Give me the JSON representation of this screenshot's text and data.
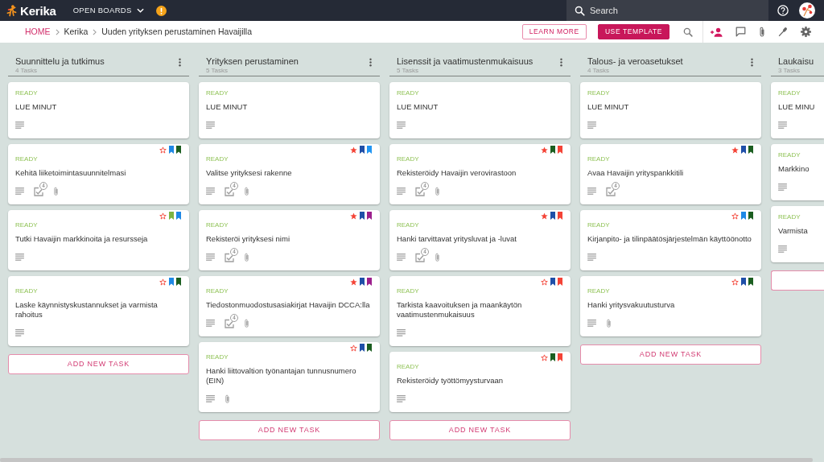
{
  "top_bar": {
    "logo": "Kerika",
    "menu": "OPEN BOARDS",
    "search": {
      "placeholder": "Search"
    }
  },
  "breadcrumb": [
    {
      "label": "HOME",
      "kind": "link"
    },
    {
      "label": "Kerika",
      "kind": "text"
    },
    {
      "label": "Uuden yrityksen perustaminen Havaijilla",
      "kind": "text"
    }
  ],
  "actions": [
    {
      "label": "LEARN MORE",
      "kind": "outline"
    },
    {
      "label": "USE TEMPLATE",
      "kind": "filled"
    }
  ],
  "columns": [
    {
      "title": "Suunnittelu ja tutkimus",
      "task_count": "4 Tasks",
      "has_menu": true,
      "tasks": [
        {
          "status": "READY",
          "title": "LUE MINUT",
          "indicators": [
            {
              "kind": "description"
            }
          ]
        },
        {
          "status": "READY",
          "title": "Kehitä liiketoimintasuunnitelmasi",
          "starred": false,
          "tags": [
            {
              "color": "#1e88e5"
            },
            {
              "color": "#1b5e20"
            }
          ],
          "indicators": [
            {
              "kind": "description"
            },
            {
              "kind": "checklist",
              "count": "4"
            },
            {
              "kind": "attachment"
            }
          ]
        },
        {
          "status": "READY",
          "title": "Tutki Havaijin markkinoita ja resursseja",
          "starred": false,
          "tags": [
            {
              "color": "#7cb342"
            },
            {
              "color": "#1e88e5"
            }
          ],
          "indicators": [
            {
              "kind": "description"
            }
          ]
        },
        {
          "status": "READY",
          "title": "Laske käynnistyskustannukset ja varmista rahoitus",
          "starred": false,
          "tags": [
            {
              "color": "#1e88e5"
            },
            {
              "color": "#1b5e20"
            }
          ],
          "indicators": [
            {
              "kind": "description"
            }
          ]
        }
      ],
      "add_button": {
        "kind": "labeled",
        "label": "ADD NEW TASK"
      }
    },
    {
      "title": "Yrityksen perustaminen",
      "task_count": "5 Tasks",
      "has_menu": true,
      "tasks": [
        {
          "status": "READY",
          "title": "LUE MINUT",
          "indicators": [
            {
              "kind": "description"
            }
          ]
        },
        {
          "status": "READY",
          "title": "Valitse yrityksesi rakenne",
          "starred": true,
          "tags": [
            {
              "color": "#1f4fa8"
            },
            {
              "color": "#2196f3"
            }
          ],
          "indicators": [
            {
              "kind": "description"
            },
            {
              "kind": "checklist",
              "count": "4"
            },
            {
              "kind": "attachment"
            }
          ]
        },
        {
          "status": "READY",
          "title": "Rekisteröi yrityksesi nimi",
          "starred": true,
          "tags": [
            {
              "color": "#1f4fa8"
            },
            {
              "color": "#9c1f8c"
            }
          ],
          "indicators": [
            {
              "kind": "description"
            },
            {
              "kind": "checklist",
              "count": "4"
            },
            {
              "kind": "attachment"
            }
          ]
        },
        {
          "status": "READY",
          "title": "Tiedostonmuodostusasiakirjat Havaijin DCCA:lla",
          "starred": true,
          "tags": [
            {
              "color": "#1f4fa8"
            },
            {
              "color": "#9c1f8c"
            }
          ],
          "indicators": [
            {
              "kind": "description"
            },
            {
              "kind": "checklist",
              "count": "4"
            },
            {
              "kind": "attachment"
            }
          ]
        },
        {
          "status": "READY",
          "title": "Hanki liittovaltion työnantajan tunnusnumero (EIN)",
          "starred": false,
          "tags": [
            {
              "color": "#1f4fa8"
            },
            {
              "color": "#1b5e20"
            }
          ],
          "indicators": [
            {
              "kind": "description"
            },
            {
              "kind": "attachment"
            }
          ]
        }
      ],
      "add_button": {
        "kind": "labeled",
        "label": "ADD NEW TASK"
      }
    },
    {
      "title": "Lisenssit ja vaatimustenmukaisuus",
      "task_count": "5 Tasks",
      "has_menu": true,
      "tasks": [
        {
          "status": "READY",
          "title": "LUE MINUT",
          "indicators": [
            {
              "kind": "description"
            }
          ]
        },
        {
          "status": "READY",
          "title": "Rekisteröidy Havaijin verovirastoon",
          "starred": true,
          "tags": [
            {
              "color": "#1b5e20"
            },
            {
              "color": "#f44336"
            }
          ],
          "indicators": [
            {
              "kind": "description"
            },
            {
              "kind": "checklist",
              "count": "4"
            },
            {
              "kind": "attachment"
            }
          ]
        },
        {
          "status": "READY",
          "title": "Hanki tarvittavat yritysluvat ja -luvat",
          "starred": true,
          "tags": [
            {
              "color": "#1f4fa8"
            },
            {
              "color": "#f44336"
            }
          ],
          "indicators": [
            {
              "kind": "description"
            },
            {
              "kind": "checklist",
              "count": "4"
            },
            {
              "kind": "attachment"
            }
          ]
        },
        {
          "status": "READY",
          "title": "Tarkista kaavoituksen ja maankäytön vaatimustenmukaisuus",
          "starred": false,
          "tags": [
            {
              "color": "#1f4fa8"
            },
            {
              "color": "#f44336"
            }
          ],
          "indicators": [
            {
              "kind": "description"
            }
          ]
        },
        {
          "status": "READY",
          "title": "Rekisteröidy työttömyysturvaan",
          "starred": false,
          "tags": [
            {
              "color": "#1b5e20"
            },
            {
              "color": "#f44336"
            }
          ],
          "indicators": [
            {
              "kind": "description"
            }
          ]
        }
      ],
      "add_button": {
        "kind": "labeled",
        "label": "ADD NEW TASK"
      }
    },
    {
      "title": "Talous- ja veroasetukset",
      "task_count": "4 Tasks",
      "has_menu": true,
      "tasks": [
        {
          "status": "READY",
          "title": "LUE MINUT",
          "indicators": [
            {
              "kind": "description"
            }
          ]
        },
        {
          "status": "READY",
          "title": "Avaa Havaijin yrityspankkitili",
          "starred": true,
          "tags": [
            {
              "color": "#1f4fa8"
            },
            {
              "color": "#1b5e20"
            }
          ],
          "indicators": [
            {
              "kind": "description"
            },
            {
              "kind": "checklist",
              "count": "4"
            }
          ]
        },
        {
          "status": "READY",
          "title": "Kirjanpito- ja tilinpäätösjärjestelmän käyttöönotto",
          "starred": false,
          "tags": [
            {
              "color": "#1e88e5"
            },
            {
              "color": "#1b5e20"
            }
          ],
          "indicators": [
            {
              "kind": "description"
            }
          ]
        },
        {
          "status": "READY",
          "title": "Hanki yritysvakuutusturva",
          "starred": false,
          "tags": [
            {
              "color": "#1f4fa8"
            },
            {
              "color": "#1b5e20"
            }
          ],
          "indicators": [
            {
              "kind": "description"
            },
            {
              "kind": "attachment"
            }
          ]
        }
      ],
      "add_button": {
        "kind": "labeled",
        "label": "ADD NEW TASK"
      }
    },
    {
      "title": "Laukaisu",
      "task_count": "3 Tasks",
      "tasks": [
        {
          "status": "READY",
          "title": "LUE MINU",
          "indicators": [
            {
              "kind": "description"
            }
          ]
        },
        {
          "status": "READY",
          "title": "Markkino",
          "indicators": [
            {
              "kind": "description"
            }
          ]
        },
        {
          "status": "READY",
          "title": "Varmista",
          "indicators": [
            {
              "kind": "description"
            }
          ]
        }
      ],
      "add_button": {
        "kind": "blank"
      }
    }
  ]
}
